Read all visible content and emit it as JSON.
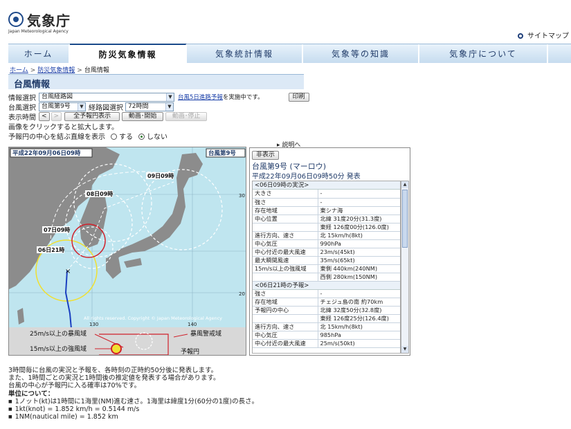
{
  "header": {
    "logo_text": "気象庁",
    "logo_en": "Japan Meteorological Agency",
    "sitemap": "サイトマップ"
  },
  "nav": {
    "tabs": [
      "ホーム",
      "防災気象情報",
      "気象統計情報",
      "気象等の知識",
      "気象庁について"
    ],
    "active": "防災気象情報"
  },
  "breadcrumb": {
    "home": "ホーム",
    "disaster": "防災気象情報",
    "current": "台風情報"
  },
  "section_title": "台風情報",
  "controls": {
    "info_label": "情報選択",
    "info_value": "台風経路図",
    "five_day_link": "台風5日進路予報",
    "five_day_suffix": "を実施中です。",
    "print": "印刷",
    "typhoon_label": "台風選択",
    "typhoon_value": "台風第9号",
    "route_label": "経路図選択",
    "route_value": "72時間",
    "time_label": "表示時間",
    "prev": "<",
    "next": ">",
    "full_range": "全予報円表示",
    "play": "動画･開始",
    "stop": "動画･停止",
    "zoom_note": "画像をクリックすると拡大します。",
    "line_label": "予報円の中心を結ぶ直線を表示",
    "opt_yes": "する",
    "opt_no": "しない",
    "explain": "説明へ"
  },
  "map": {
    "date_label": "平成22年09月06日09時",
    "typhoon_label": "台風第9号",
    "labels": [
      "09日09時",
      "08日09時",
      "07日09時",
      "06日21時"
    ],
    "copyright": "All rights reserved. Copyright © Japan Meteorological Agency",
    "lon_130": "130",
    "lon_140": "140",
    "lat_20": "20",
    "lat_30": "30",
    "legend": {
      "storm_area": "25m/s以上の暴風域",
      "strong_area": "15m/s以上の強風域",
      "storm_warn": "暴風警戒域",
      "forecast_circle": "予報円"
    }
  },
  "panel": {
    "hide": "非表示",
    "title": "台風第9号 (マーロウ)",
    "issued": "平成22年09月06日09時50分 発表",
    "sections": [
      {
        "header": "<06日09時の実況>",
        "rows": [
          [
            "大きさ",
            "-"
          ],
          [
            "強さ",
            "-"
          ],
          [
            "存在地域",
            "東シナ海"
          ],
          [
            "中心位置",
            "北緯 31度20分(31.3度)"
          ],
          [
            "",
            "東経 126度00分(126.0度)"
          ],
          [
            "進行方向、速さ",
            "北 15km/h(8kt)"
          ],
          [
            "中心気圧",
            "990hPa"
          ],
          [
            "中心付近の最大風速",
            "23m/s(45kt)"
          ],
          [
            "最大瞬間風速",
            "35m/s(65kt)"
          ],
          [
            "15m/s以上の強風域",
            "東側 440km(240NM)"
          ],
          [
            "",
            "西側 280km(150NM)"
          ]
        ]
      },
      {
        "header": "<06日21時の予報>",
        "rows": [
          [
            "強さ",
            "-"
          ],
          [
            "存在地域",
            "チェジュ島の南 約70km"
          ],
          [
            "予報円の中心",
            "北緯 32度50分(32.8度)"
          ],
          [
            "",
            "東経 126度25分(126.4度)"
          ],
          [
            "進行方向、速さ",
            "北 15km/h(8kt)"
          ],
          [
            "中心気圧",
            "985hPa"
          ],
          [
            "中心付近の最大風速",
            "25m/s(50kt)"
          ]
        ]
      }
    ]
  },
  "notes": {
    "lines": [
      "3時間毎に台風の実況と予報を、各時刻の正時約50分後に発表します。",
      "また、1時間ごとの実況と1時間後の推定値を発表する場合があります。",
      "台風の中心が予報円に入る確率は70%です。"
    ],
    "units_title": "単位について：",
    "units": [
      "1ノット(kt)は1時間に1海里(NM)進む速さ。1海里は緯度1分(60分の1度)の長さ。",
      "1kt(knot) = 1.852 km/h = 0.5144 m/s",
      "1NM(nautical mile) = 1.852 km"
    ]
  },
  "colors": {
    "nav_active_border": "#1a4a8a",
    "link": "#1a3fa8",
    "storm": "#d0202a",
    "strong": "#f0e030",
    "track": "#1a3fc0"
  }
}
